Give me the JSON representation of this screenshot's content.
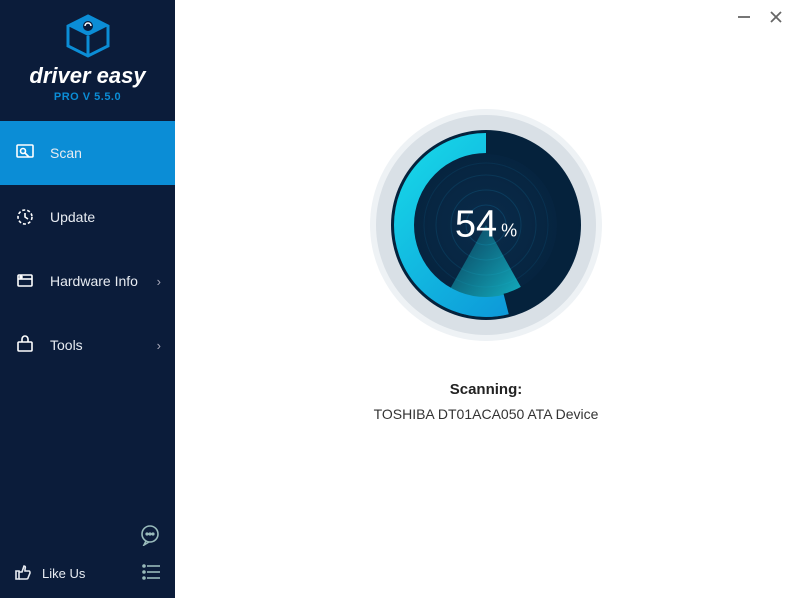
{
  "brand": {
    "name": "driver easy",
    "version": "PRO V 5.5.0"
  },
  "nav": {
    "scan": "Scan",
    "update": "Update",
    "hardware": "Hardware Info",
    "tools": "Tools"
  },
  "footer": {
    "like": "Like Us"
  },
  "scan": {
    "percent": "54",
    "symbol": "%",
    "status_label": "Scanning:",
    "current_item": "TOSHIBA DT01ACA050 ATA Device"
  },
  "colors": {
    "accent": "#0b8dd6",
    "sidebar": "#0b1c3a"
  }
}
